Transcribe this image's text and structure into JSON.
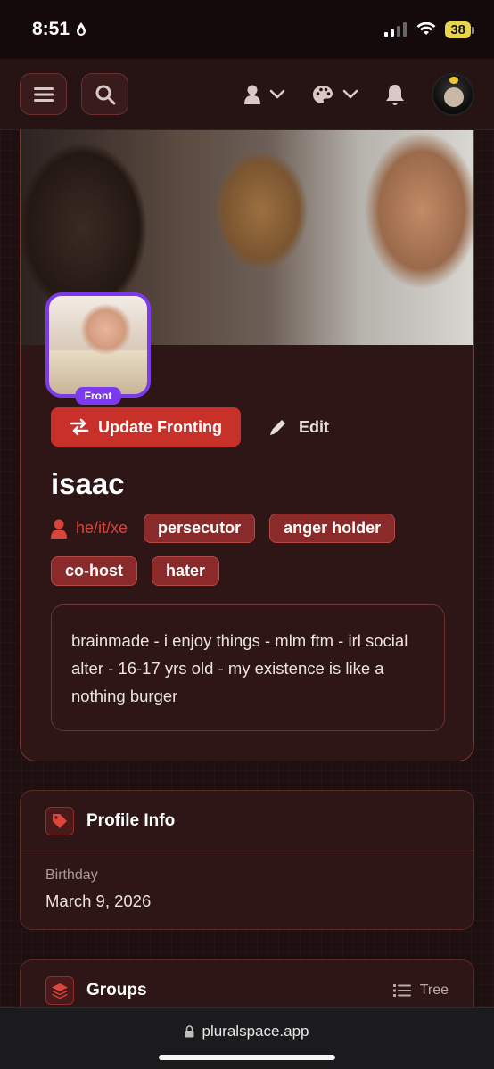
{
  "status_bar": {
    "time": "8:51",
    "battery": "38"
  },
  "header": {
    "menu_icon": "hamburger-icon",
    "search_icon": "search-icon",
    "user_icon": "user-icon",
    "palette_icon": "palette-icon",
    "bell_icon": "bell-icon"
  },
  "member": {
    "front_badge": "Front",
    "update_button": "Update Fronting",
    "edit_button": "Edit",
    "name": "isaac",
    "pronouns": "he/it/xe",
    "tags": [
      "persecutor",
      "anger holder",
      "co-host",
      "hater"
    ],
    "bio": "brainmade - i enjoy things - mlm ftm - irl social alter - 16-17 yrs old - my existence is like a nothing burger"
  },
  "profile_info": {
    "title": "Profile Info",
    "birthday_label": "Birthday",
    "birthday_value": "March 9, 2026"
  },
  "groups": {
    "title": "Groups",
    "view_label": "Tree"
  },
  "browser": {
    "url": "pluralspace.app"
  },
  "colors": {
    "accent_red": "#c8302a",
    "front_purple": "#7c3aed",
    "background": "#1e0f10"
  }
}
